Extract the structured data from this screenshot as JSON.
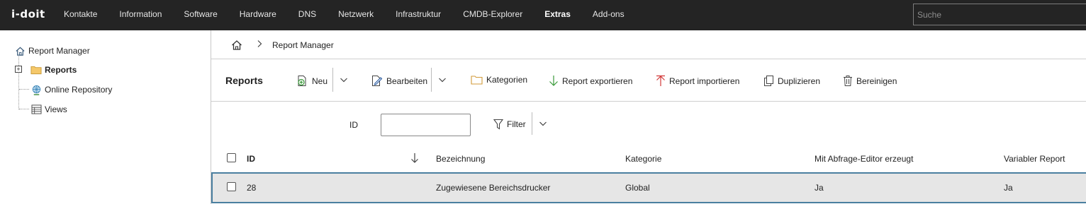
{
  "app": {
    "logo": "i-doit"
  },
  "nav": {
    "items": [
      {
        "label": "Kontakte",
        "active": false
      },
      {
        "label": "Information",
        "active": false
      },
      {
        "label": "Software",
        "active": false
      },
      {
        "label": "Hardware",
        "active": false
      },
      {
        "label": "DNS",
        "active": false
      },
      {
        "label": "Netzwerk",
        "active": false
      },
      {
        "label": "Infrastruktur",
        "active": false
      },
      {
        "label": "CMDB-Explorer",
        "active": false
      },
      {
        "label": "Extras",
        "active": true
      },
      {
        "label": "Add-ons",
        "active": false
      }
    ],
    "search_placeholder": "Suche"
  },
  "sidebar": {
    "root": {
      "label": "Report Manager",
      "icon": "home-icon"
    },
    "items": [
      {
        "label": "Reports",
        "icon": "folder-icon",
        "expander": "+"
      },
      {
        "label": "Online Repository",
        "icon": "globe-icon"
      },
      {
        "label": "Views",
        "icon": "table-icon"
      }
    ]
  },
  "breadcrumb": {
    "home_icon": "home-icon",
    "separator": ">",
    "current": "Report Manager"
  },
  "toolbar": {
    "title": "Reports",
    "new_label": "Neu",
    "edit_label": "Bearbeiten",
    "categories_label": "Kategorien",
    "export_label": "Report exportieren",
    "import_label": "Report importieren",
    "duplicate_label": "Duplizieren",
    "cleanup_label": "Bereinigen"
  },
  "filter": {
    "id_label": "ID",
    "id_value": "",
    "filter_label": "Filter"
  },
  "table": {
    "columns": [
      "ID",
      "Bezeichnung",
      "Kategorie",
      "Mit Abfrage-Editor erzeugt",
      "Variabler Report"
    ],
    "rows": [
      {
        "id": "28",
        "bezeichnung": "Zugewiesene Bereichsdrucker",
        "kategorie": "Global",
        "abfrage_editor": "Ja",
        "variabler": "Ja"
      }
    ]
  },
  "colors": {
    "topbar": "#242424",
    "row_selected_border": "#4a7fa0",
    "folder": "#f0c060",
    "export_arrow": "#3a9a3a",
    "import_arrow": "#d23a3a"
  }
}
